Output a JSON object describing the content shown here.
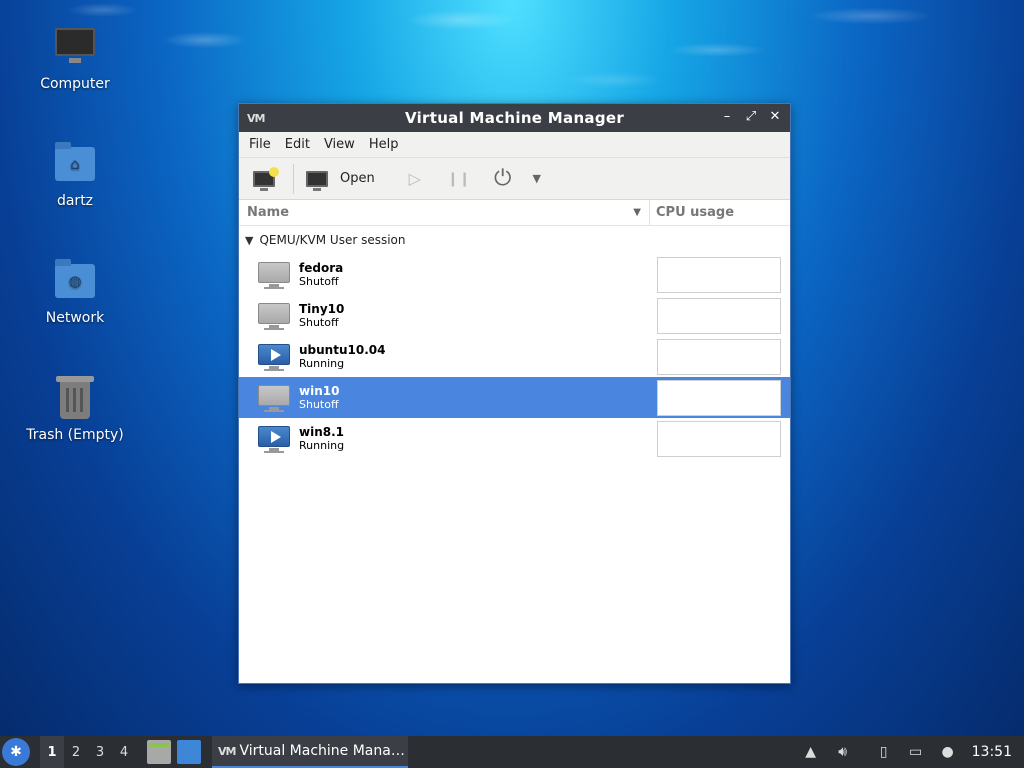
{
  "desktop": {
    "icons": [
      {
        "label": "Computer"
      },
      {
        "label": "dartz"
      },
      {
        "label": "Network"
      },
      {
        "label": "Trash (Empty)"
      }
    ]
  },
  "window": {
    "app_logo": "VM",
    "title": "Virtual Machine Manager",
    "menu": [
      "File",
      "Edit",
      "View",
      "Help"
    ],
    "toolbar": {
      "open_label": "Open"
    },
    "columns": {
      "name": "Name",
      "cpu": "CPU usage"
    },
    "group": "QEMU/KVM User session",
    "vms": [
      {
        "name": "fedora",
        "status": "Shutoff"
      },
      {
        "name": "Tiny10",
        "status": "Shutoff"
      },
      {
        "name": "ubuntu10.04",
        "status": "Running"
      },
      {
        "name": "win10",
        "status": "Shutoff",
        "selected": true
      },
      {
        "name": "win8.1",
        "status": "Running"
      }
    ]
  },
  "taskbar": {
    "workspaces": [
      "1",
      "2",
      "3",
      "4"
    ],
    "active_workspace": "1",
    "task_logo": "VM",
    "task_label": "Virtual Machine Mana…",
    "clock": "13:51"
  },
  "colors": {
    "selection": "#4a86e0",
    "titlebar": "#3b3f45",
    "taskbar": "#2b2e33"
  }
}
